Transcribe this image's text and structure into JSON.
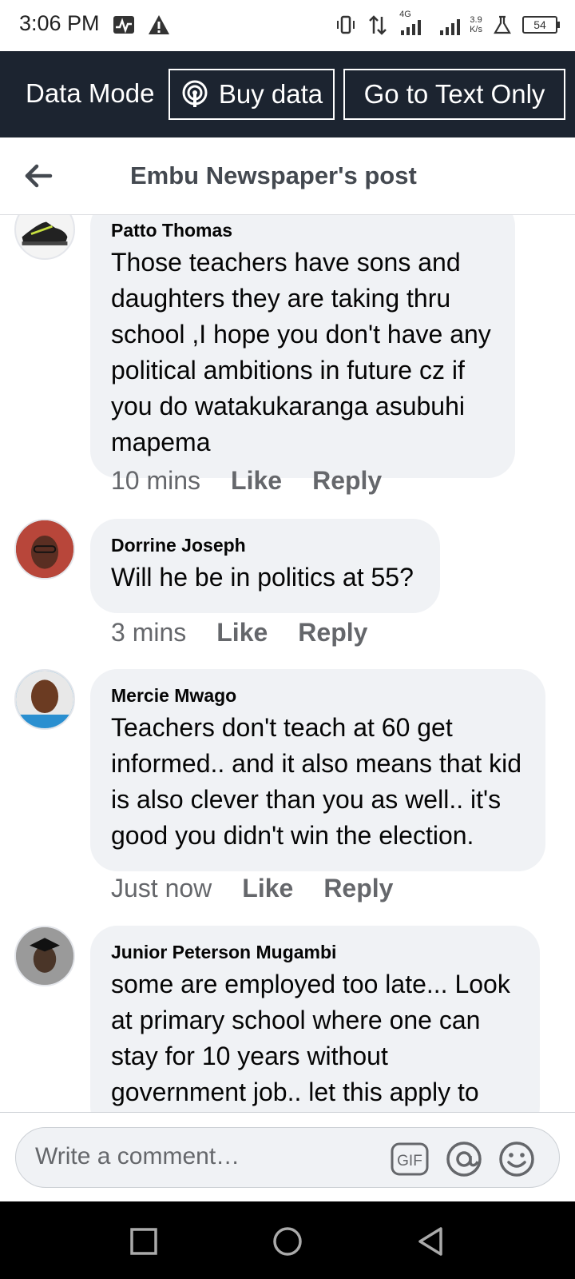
{
  "status_bar": {
    "time": "3:06 PM",
    "network": "4G",
    "speed_value": "3.9",
    "speed_unit": "K/s",
    "battery": "54"
  },
  "data_bar": {
    "mode_label": "Data Mode",
    "buy_label": "Buy data",
    "text_only_label": "Go to Text Only"
  },
  "header": {
    "title": "Embu Newspaper's post"
  },
  "comments": [
    {
      "author": "Patto Thomas",
      "text": "Those teachers have sons and daughters they are taking thru school ,I hope you don't have any political ambitions in future cz if you do watakukaranga asubuhi mapema",
      "time": "10 mins",
      "like": "Like",
      "reply": "Reply"
    },
    {
      "author": "Dorrine Joseph",
      "text": "Will he be in politics at 55?",
      "time": "3 mins",
      "like": "Like",
      "reply": "Reply"
    },
    {
      "author": "Mercie Mwago",
      "text": "Teachers don't teach at 60 get informed.. and it also means that kid is also clever than you as well.. it's good you didn't win the election.",
      "time": "Just now",
      "like": "Like",
      "reply": "Reply"
    },
    {
      "author": "Junior Peterson Mugambi",
      "text": "some are employed too late... Look at primary school where one can stay for 10 years without government job.. let this apply to"
    }
  ],
  "composer": {
    "placeholder": "Write a comment…"
  },
  "icons": {
    "gif": "gif-icon",
    "mention": "at-icon",
    "emoji": "smiley-icon"
  }
}
